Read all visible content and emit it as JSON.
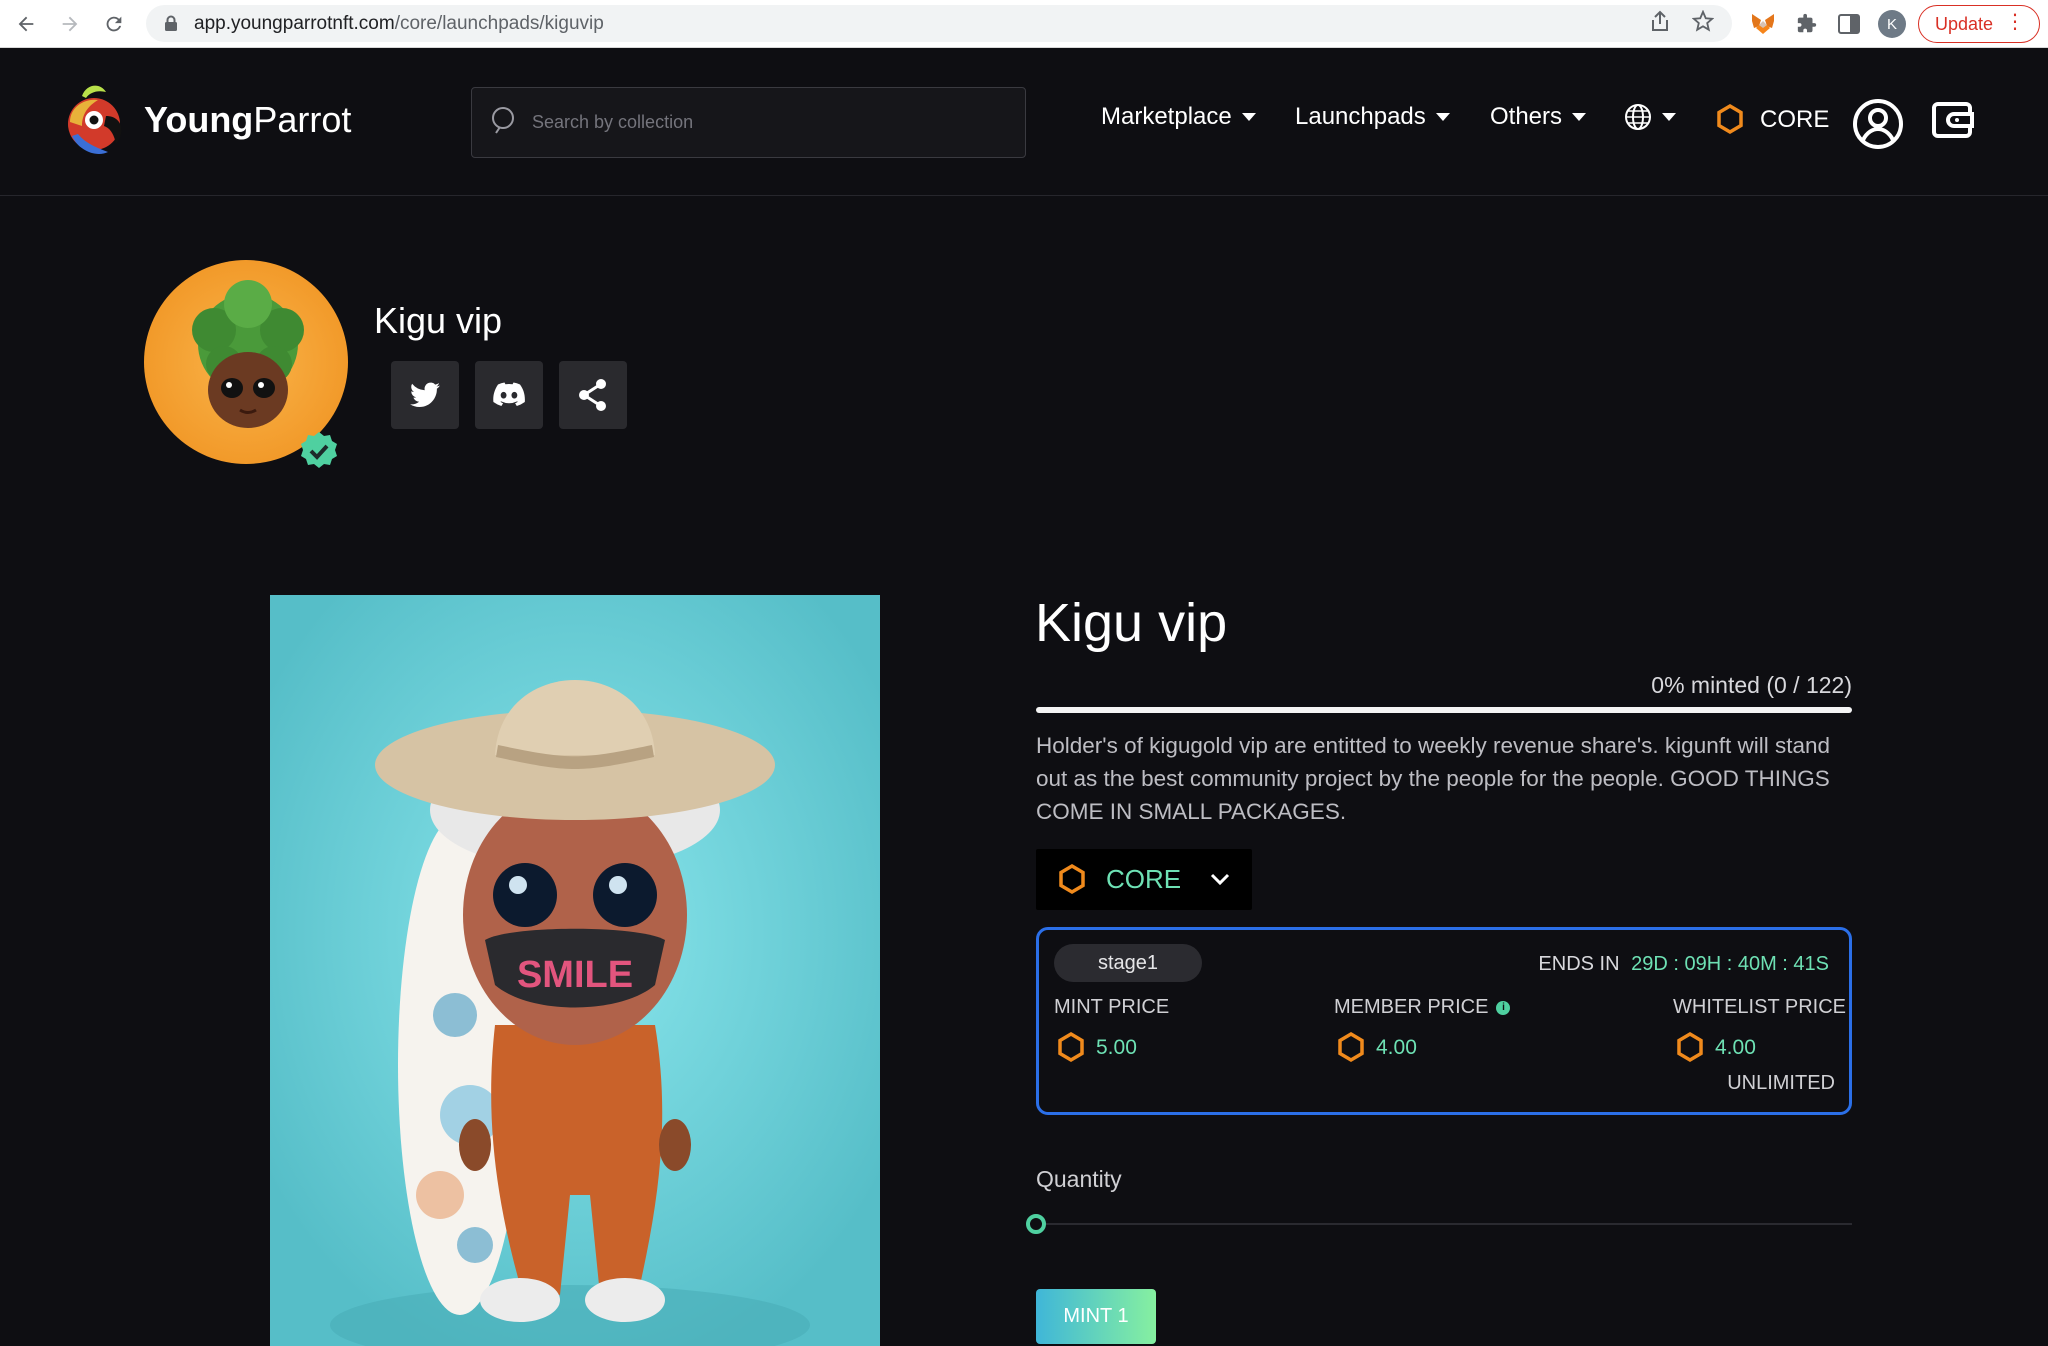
{
  "browser": {
    "url_host": "app.youngparrotnft.com",
    "url_path": "/core/launchpads/kiguvip",
    "profile_initial": "K",
    "update_label": "Update"
  },
  "header": {
    "logo_bold": "Young",
    "logo_light": "Parrot",
    "search_placeholder": "Search by collection",
    "nav": [
      "Marketplace",
      "Launchpads",
      "Others"
    ],
    "chain_label": "CORE"
  },
  "profile": {
    "name": "Kigu vip"
  },
  "launch": {
    "title": "Kigu vip",
    "minted_text": "0% minted (0 / 122)",
    "minted_fraction": 0,
    "description": "Holder's of kigugold vip are entitted to weekly revenue share's. kigunft will stand out as the best community project by the people for the people. GOOD THINGS COME IN SMALL PACKAGES.",
    "currency": "CORE",
    "stage": {
      "name": "stage1",
      "ends_label": "ENDS IN",
      "ends_time": "29D : 09H : 40M : 41S",
      "mint_price_label": "MINT PRICE",
      "mint_price": "5.00",
      "member_price_label": "MEMBER PRICE",
      "member_price": "4.00",
      "whitelist_price_label": "WHITELIST PRICE",
      "whitelist_price": "4.00",
      "limit": "UNLIMITED"
    },
    "quantity_label": "Quantity",
    "quantity_value": 1,
    "mint_button": "MINT 1"
  },
  "colors": {
    "accent_green": "#6ee1b4",
    "accent_blue": "#2b6fe8",
    "core_orange": "#f08a1c"
  }
}
